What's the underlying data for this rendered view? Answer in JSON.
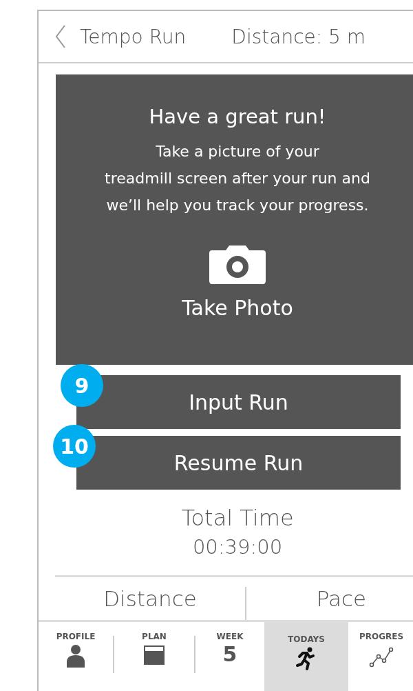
{
  "header": {
    "title": "Tempo Run",
    "subtitle": "Distance: 5 m"
  },
  "card": {
    "heading": "Have a great run!",
    "lines": [
      "Take a picture of your",
      "treadmill screen after your run and",
      "we’ll help you track your progress."
    ],
    "action": "Take Photo"
  },
  "buttons": [
    {
      "label": "Input Run",
      "badge": "9"
    },
    {
      "label": "Resume Run",
      "badge": "10"
    }
  ],
  "total": {
    "label": "Total Time",
    "value": "00:39:00"
  },
  "stats": [
    "Distance",
    "Pace"
  ],
  "tabs": [
    {
      "label": "PROFILE",
      "kind": "person",
      "selected": false
    },
    {
      "label": "PLAN",
      "kind": "calendar",
      "selected": false
    },
    {
      "label": "WEEK",
      "kind": "number",
      "value": "5",
      "selected": false
    },
    {
      "label": "TODAYS",
      "kind": "runner",
      "selected": true
    },
    {
      "label": "PROGRES",
      "kind": "chart",
      "selected": false
    }
  ]
}
